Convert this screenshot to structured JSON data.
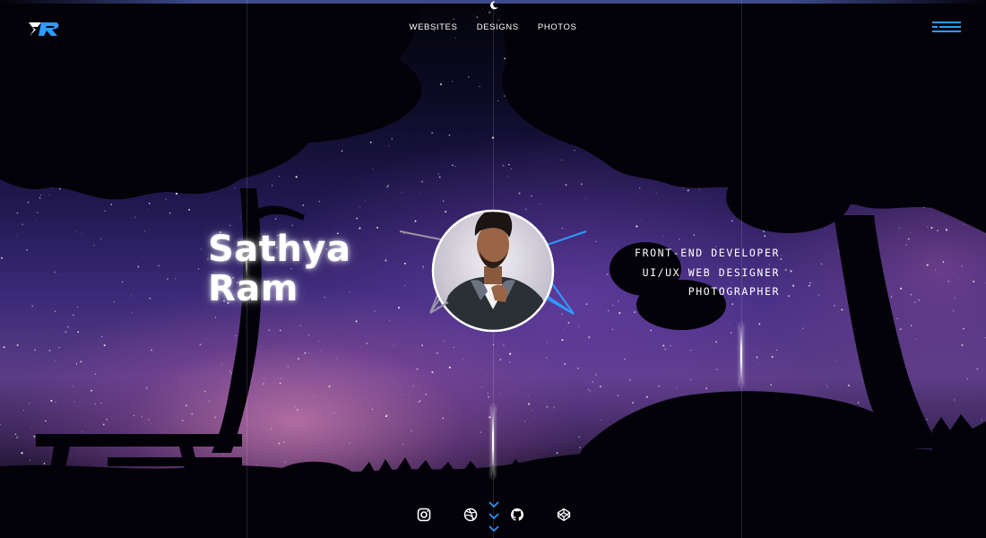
{
  "nav": {
    "items": [
      {
        "label": "WEBSITES"
      },
      {
        "label": "DESIGNS"
      },
      {
        "label": "PHOTOS"
      }
    ]
  },
  "hero": {
    "name_first": "Sathya",
    "name_last": "Ram",
    "roles": [
      "FRONT-END DEVELOPER",
      "UI/UX WEB DESIGNER",
      "PHOTOGRAPHER"
    ]
  },
  "social": [
    "instagram-icon",
    "dribbble-icon",
    "github-icon",
    "codepen-icon"
  ],
  "colors": {
    "accent": "#2e9bff",
    "text": "#ffffff",
    "topbar": "#3e4a8e"
  }
}
